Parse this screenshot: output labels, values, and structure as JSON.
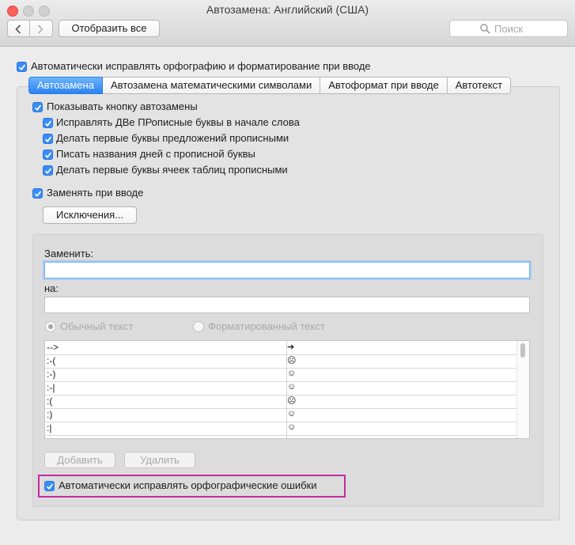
{
  "window": {
    "title": "Автозамена: Английский (США)"
  },
  "toolbar": {
    "show_all": "Отобразить все",
    "search_placeholder": "Поиск"
  },
  "main_option": "Автоматически исправлять орфографию и форматирование при вводе",
  "tabs": [
    {
      "label": "Автозамена",
      "active": true
    },
    {
      "label": "Автозамена математическими символами",
      "active": false
    },
    {
      "label": "Автоформат при вводе",
      "active": false
    },
    {
      "label": "Автотекст",
      "active": false
    }
  ],
  "options": {
    "show_button": "Показывать кнопку автозамены",
    "items": [
      "Исправлять ДВе ПРописные буквы в начале слова",
      "Делать первые буквы предложений прописными",
      "Писать названия дней с прописной буквы",
      "Делать первые буквы ячеек таблиц прописными"
    ],
    "replace_as_type": "Заменять при вводе",
    "exceptions_button": "Исключения..."
  },
  "replace": {
    "replace_label": "Заменить:",
    "with_label": "на:",
    "replace_value": "",
    "with_value": "",
    "plain_text": "Обычный текст",
    "formatted_text": "Форматированный текст"
  },
  "table_rows": [
    {
      "from": "-->",
      "to": "➔"
    },
    {
      "from": ":-(",
      "to": "☹"
    },
    {
      "from": ":-)",
      "to": "☺"
    },
    {
      "from": ":-|",
      "to": "☺"
    },
    {
      "from": ":(",
      "to": "☹"
    },
    {
      "from": ":)",
      "to": "☺"
    },
    {
      "from": ":|",
      "to": "☺"
    }
  ],
  "buttons": {
    "add": "Добавить",
    "delete": "Удалить"
  },
  "spelling_option": "Автоматически исправлять орфографические ошибки",
  "colors": {
    "accent": "#3a8cf8",
    "highlight_border": "#c42aa0"
  }
}
